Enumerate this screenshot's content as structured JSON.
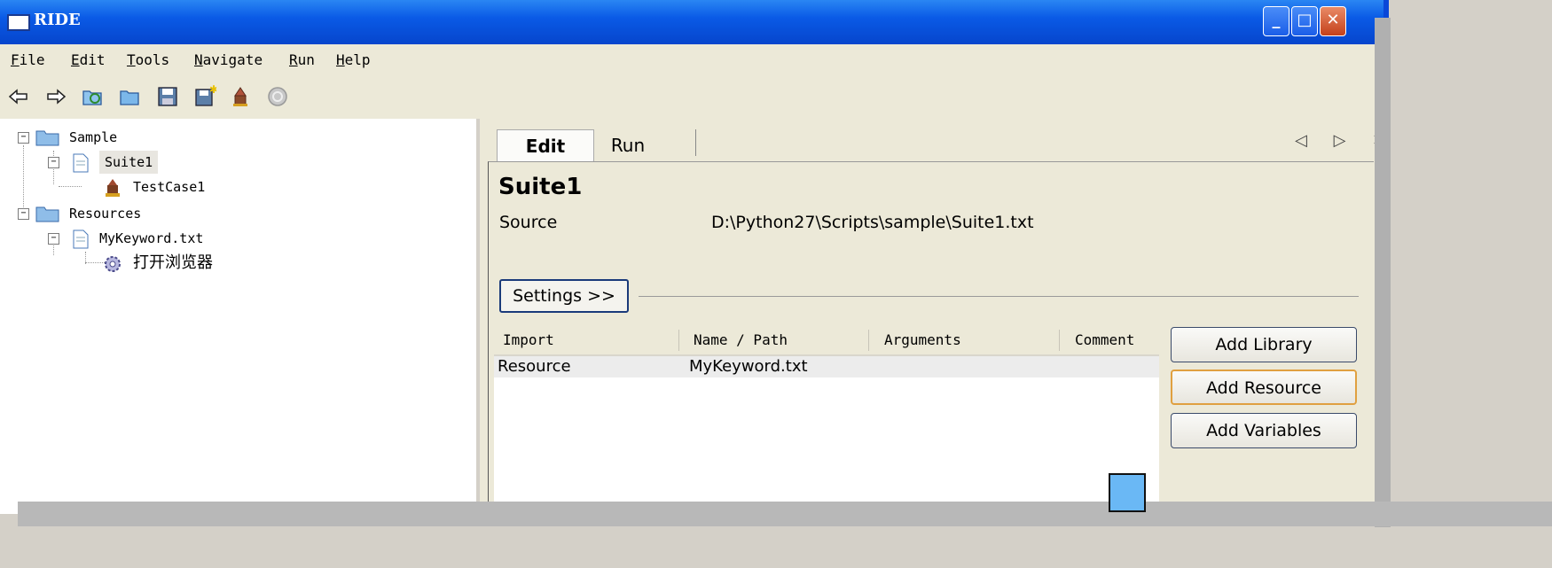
{
  "window": {
    "title": "RIDE",
    "controls": [
      "minimize-icon",
      "maximize-icon",
      "close-icon"
    ]
  },
  "menubar": {
    "items": [
      "File",
      "Edit",
      "Tools",
      "Navigate",
      "Run",
      "Help"
    ]
  },
  "toolbar": {
    "icons": [
      "back-arrow-icon",
      "forward-arrow-icon",
      "open-folder-refresh-icon",
      "open-folder-icon",
      "save-icon",
      "save-all-icon",
      "robot-run-icon",
      "stop-icon"
    ]
  },
  "tree": {
    "nodes": [
      {
        "label": "Sample",
        "icon": "folder-icon",
        "level": 0
      },
      {
        "label": "Suite1",
        "icon": "file-icon",
        "level": 1,
        "selected": true
      },
      {
        "label": "TestCase1",
        "icon": "testcase-icon",
        "level": 2
      },
      {
        "label": "Resources",
        "icon": "folder-icon",
        "level": 0
      },
      {
        "label": "MyKeyword.txt",
        "icon": "file-icon",
        "level": 1
      },
      {
        "label": "打开浏览器",
        "icon": "keyword-gear-icon",
        "level": 2
      }
    ]
  },
  "tabs": {
    "items": [
      {
        "label": "Edit",
        "active": true
      },
      {
        "label": "Run",
        "active": false
      }
    ],
    "controls": "◁ ▷ ✕"
  },
  "editor": {
    "title": "Suite1",
    "source_label": "Source",
    "source_value": "D:\\Python27\\Scripts\\sample\\Suite1.txt",
    "settings_button": "Settings >>"
  },
  "imports": {
    "columns": [
      "Import",
      "Name / Path",
      "Arguments",
      "Comment"
    ],
    "rows": [
      {
        "import": "Resource",
        "name_path": "MyKeyword.txt",
        "arguments": "",
        "comment": ""
      }
    ]
  },
  "side_buttons": {
    "add_library": "Add Library",
    "add_resource": "Add Resource",
    "add_variables": "Add Variables"
  },
  "colors": {
    "titlebar": "#0a5ae6",
    "window_bg": "#ece9d8",
    "focus_border": "#e0a040"
  }
}
